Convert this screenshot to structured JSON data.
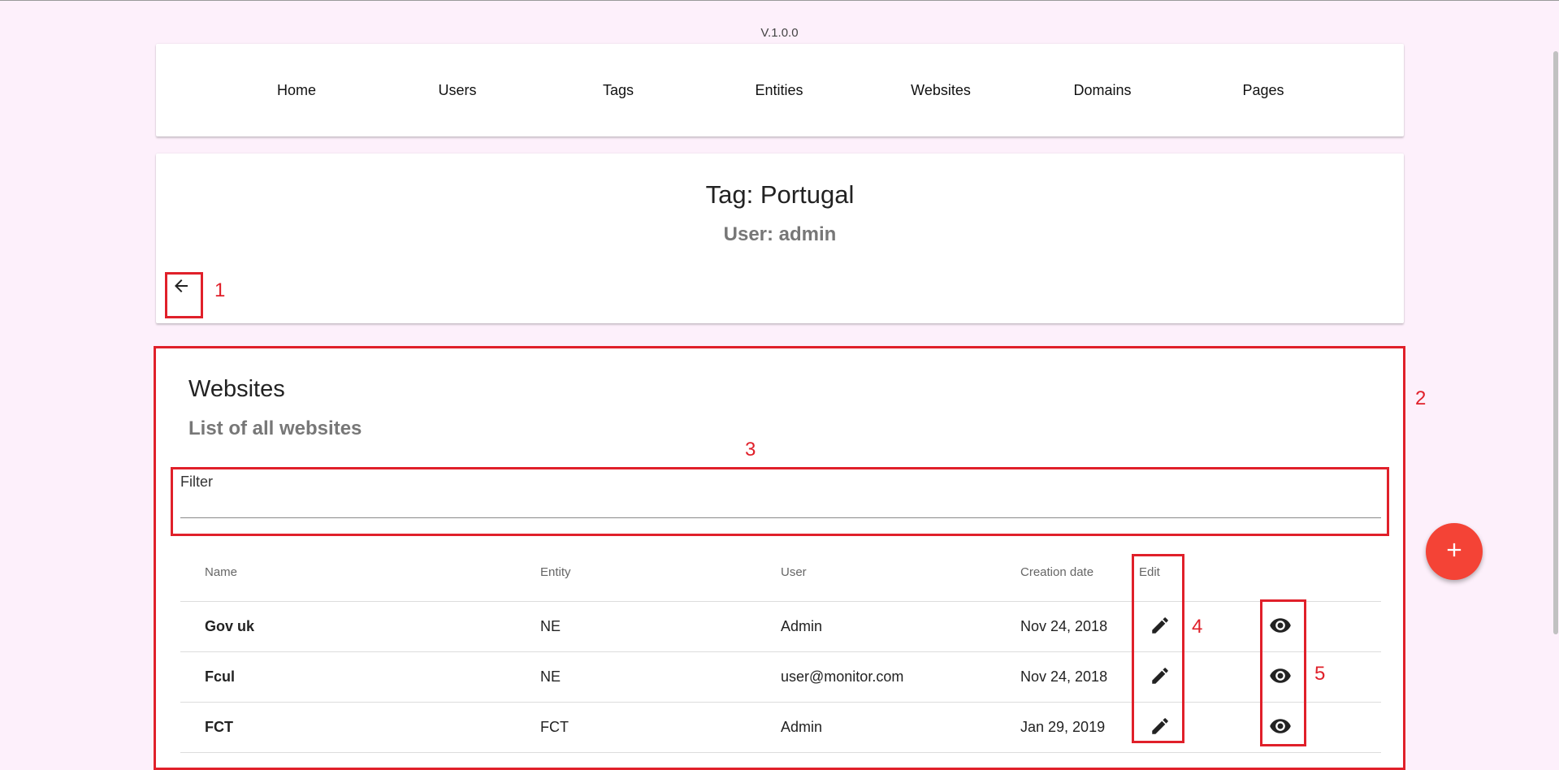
{
  "version": "V.1.0.0",
  "nav": {
    "items": [
      {
        "label": "Home"
      },
      {
        "label": "Users"
      },
      {
        "label": "Tags"
      },
      {
        "label": "Entities"
      },
      {
        "label": "Websites"
      },
      {
        "label": "Domains"
      },
      {
        "label": "Pages"
      }
    ]
  },
  "tag": {
    "title": "Tag: Portugal",
    "subtitle": "User: admin"
  },
  "annotations": {
    "n1": "1",
    "n2": "2",
    "n3": "3",
    "n4": "4",
    "n5": "5",
    "color": "#e0202a"
  },
  "websites": {
    "title": "Websites",
    "subtitle": "List of all websites",
    "filter_label": "Filter",
    "filter_value": "",
    "columns": {
      "name": "Name",
      "entity": "Entity",
      "user": "User",
      "creation_date": "Creation date",
      "edit": "Edit"
    },
    "rows": [
      {
        "name": "Gov uk",
        "entity": "NE",
        "user": "Admin",
        "creation_date": "Nov 24, 2018"
      },
      {
        "name": "Fcul",
        "entity": "NE",
        "user": "user@monitor.com",
        "creation_date": "Nov 24, 2018"
      },
      {
        "name": "FCT",
        "entity": "FCT",
        "user": "Admin",
        "creation_date": "Jan 29, 2019"
      }
    ]
  },
  "icons": {
    "back": "arrow-back-icon",
    "edit": "pencil-icon",
    "view": "eye-icon",
    "add": "plus-icon"
  },
  "colors": {
    "background": "#fdf0fb",
    "fab": "#f44336"
  }
}
